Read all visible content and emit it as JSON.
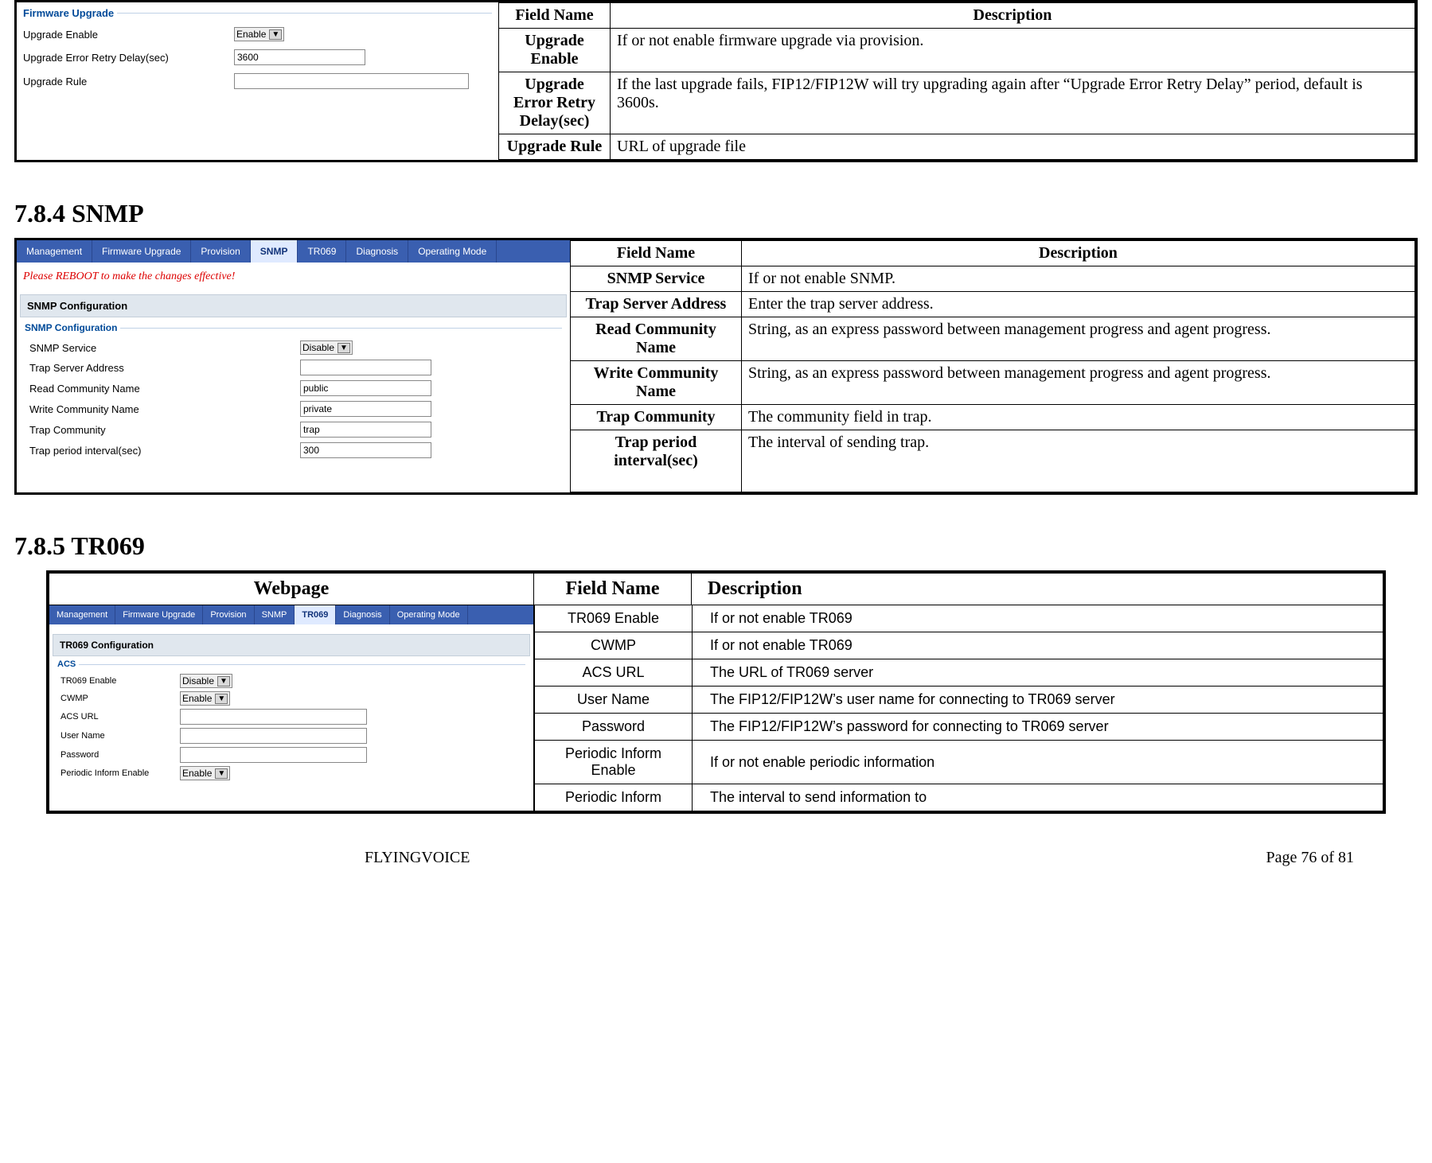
{
  "firmware": {
    "fieldset_title": "Firmware Upgrade",
    "rows": {
      "upgrade_enable_label": "Upgrade Enable",
      "upgrade_enable_value": "Enable",
      "retry_delay_label": "Upgrade Error Retry Delay(sec)",
      "retry_delay_value": "3600",
      "upgrade_rule_label": "Upgrade Rule",
      "upgrade_rule_value": ""
    },
    "desc_hdr_field": "Field Name",
    "desc_hdr_desc": "Description",
    "desc": [
      {
        "name": "Upgrade Enable",
        "text": "If or not enable firmware upgrade via provision."
      },
      {
        "name": "Upgrade Error Retry Delay(sec)",
        "text": "If the last upgrade fails, FIP12/FIP12W will try upgrading again after “Upgrade Error Retry Delay” period, default is 3600s."
      },
      {
        "name": "Upgrade Rule",
        "text": "URL of upgrade file"
      }
    ]
  },
  "sec784_title": "7.8.4   SNMP",
  "snmp": {
    "tabs": [
      "Management",
      "Firmware Upgrade",
      "Provision",
      "SNMP",
      "TR069",
      "Diagnosis",
      "Operating Mode"
    ],
    "active_tab_index": 3,
    "reboot_msg": "Please REBOOT to make the changes effective!",
    "panel_title": "SNMP Configuration",
    "fieldset_title": "SNMP Configuration",
    "rows": {
      "service_label": "SNMP Service",
      "service_value": "Disable",
      "trap_addr_label": "Trap Server Address",
      "trap_addr_value": "",
      "read_comm_label": "Read Community Name",
      "read_comm_value": "public",
      "write_comm_label": "Write Community Name",
      "write_comm_value": "private",
      "trap_comm_label": "Trap Community",
      "trap_comm_value": "trap",
      "trap_period_label": "Trap period interval(sec)",
      "trap_period_value": "300"
    },
    "desc_hdr_field": "Field Name",
    "desc_hdr_desc": "Description",
    "desc": [
      {
        "name": "SNMP Service",
        "text": "If or not enable SNMP."
      },
      {
        "name": "Trap Server Address",
        "text": "Enter the trap server address."
      },
      {
        "name": "Read Community Name",
        "text": "String, as an express password between management progress and agent progress."
      },
      {
        "name": "Write Community Name",
        "text": "String, as an express password between management progress and agent progress."
      },
      {
        "name": "Trap Community",
        "text": "The community field in trap."
      },
      {
        "name": "Trap period interval(sec)",
        "text": "The interval of sending trap."
      }
    ]
  },
  "sec785_title": "7.8.5   TR069",
  "tr069": {
    "hdr_webpage": "Webpage",
    "hdr_field": "Field Name",
    "hdr_desc": "Description",
    "tabs": [
      "Management",
      "Firmware Upgrade",
      "Provision",
      "SNMP",
      "TR069",
      "Diagnosis",
      "Operating Mode"
    ],
    "active_tab_index": 4,
    "panel_title": "TR069 Configuration",
    "fieldset_title": "ACS",
    "rows": {
      "enable_label": "TR069 Enable",
      "enable_value": "Disable",
      "cwmp_label": "CWMP",
      "cwmp_value": "Enable",
      "acs_url_label": "ACS URL",
      "acs_url_value": "",
      "user_label": "User Name",
      "user_value": "",
      "pass_label": "Password",
      "pass_value": "",
      "pinf_label": "Periodic Inform Enable",
      "pinf_value": "Enable"
    },
    "desc": [
      {
        "name": "TR069 Enable",
        "text": "If or not enable TR069"
      },
      {
        "name": "CWMP",
        "text": "If or not enable TR069"
      },
      {
        "name": "ACS URL",
        "text": "The URL of TR069 server"
      },
      {
        "name": "User Name",
        "text": "The FIP12/FIP12W’s user name for connecting to TR069 server"
      },
      {
        "name": "Password",
        "text": "The FIP12/FIP12W’s password for connecting to TR069 server"
      },
      {
        "name": "Periodic Inform Enable",
        "text": "If or not enable periodic information"
      },
      {
        "name": "Periodic Inform",
        "text": "The interval to send information to"
      }
    ]
  },
  "footer": {
    "brand": "FLYINGVOICE",
    "page": "Page  76  of  81"
  }
}
